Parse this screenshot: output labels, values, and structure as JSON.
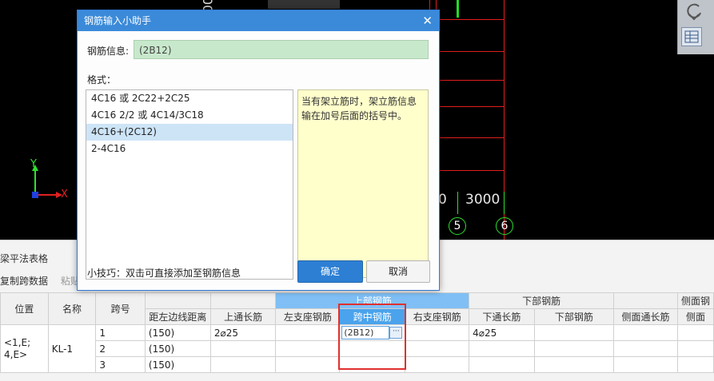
{
  "dialog": {
    "title": "钢筋输入小助手",
    "info_label": "钢筋信息:",
    "info_value": "(2B12)",
    "format_label": "格式：",
    "formats": [
      "4C16 或 2C22+2C25",
      "4C16 2/2 或 4C14/3C18",
      "4C16+(2C12)",
      "2-4C16"
    ],
    "selected_index": 2,
    "hint": "当有架立筋时，架立筋信息输在加号后面的括号中。",
    "tip": "小技巧：双击可直接添加至钢筋信息",
    "ok_label": "确定",
    "cancel_label": "取消"
  },
  "cad": {
    "dim_text_1": "0",
    "dim_text_2": "3000",
    "axis_5": "5",
    "axis_6": "6",
    "axis_x": "X",
    "axis_y": "Y",
    "partial_top": "00"
  },
  "panel": {
    "title": "梁平法表格",
    "tool_copy": "复制跨数据",
    "tool_paste": "粘贴"
  },
  "table": {
    "headers": {
      "position": "位置",
      "name": "名称",
      "span": "跨号",
      "left_dist": "距左边线距离",
      "top_through": "上通长筋",
      "top_group": "上部钢筋",
      "left_support": "左支座钢筋",
      "mid_span": "跨中钢筋",
      "right_support": "右支座钢筋",
      "bottom_group": "下部钢筋",
      "bottom_through": "下通长筋",
      "bottom_rebar": "下部钢筋",
      "side_through": "侧面通长筋",
      "side_group": "侧面钢",
      "side_short": "侧面"
    },
    "position_value": "<1,E;\n4,E>",
    "position_line1": "<1,E;",
    "position_line2": "4,E>",
    "name_value": "KL-1",
    "rows": [
      {
        "span": "1",
        "dist": "(150)",
        "top_through": "2⌀25",
        "mid": "(2B12)",
        "bottom_through": "4⌀25"
      },
      {
        "span": "2",
        "dist": "(150)",
        "top_through": "",
        "mid": "",
        "bottom_through": ""
      },
      {
        "span": "3",
        "dist": "(150)",
        "top_through": "",
        "mid": "",
        "bottom_through": ""
      }
    ]
  }
}
